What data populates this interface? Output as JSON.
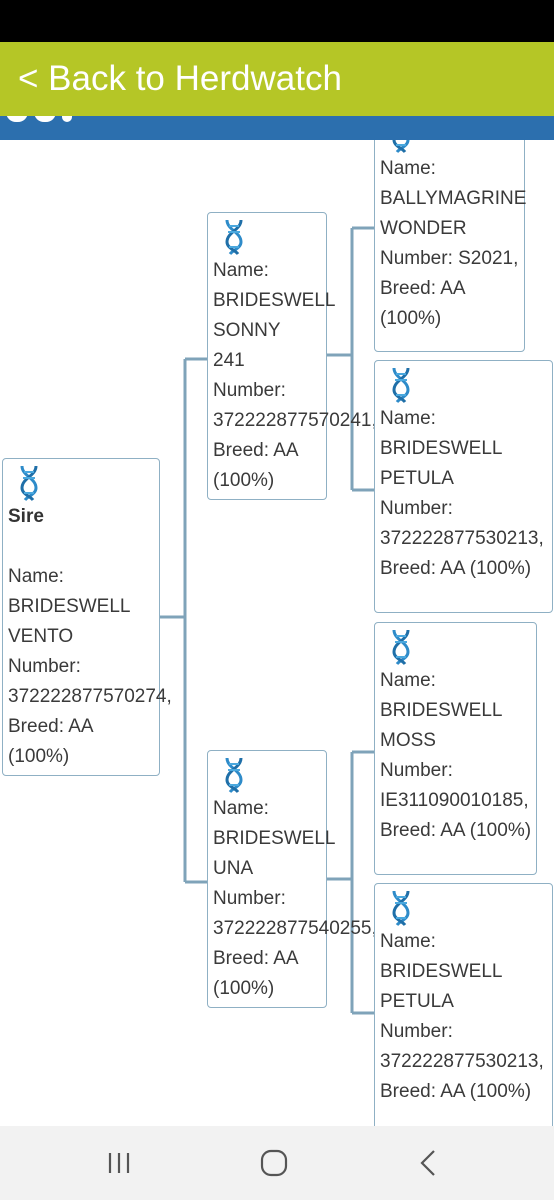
{
  "header": {
    "back_label": "< Back to Herdwatch"
  },
  "icons": {
    "dna": "dna-icon",
    "recents": "recent-apps-icon",
    "home": "home-icon",
    "back": "back-icon"
  },
  "colors": {
    "header_bg": "#b5c626",
    "band": "#2c6fae",
    "card_border": "#8fb0c4",
    "connector": "#7fa3b9"
  },
  "pedigree": {
    "sire": {
      "label": "Sire",
      "name_label": "Name:",
      "name": [
        "BRIDESWELL",
        "VENTO"
      ],
      "number_label": "Number:",
      "number": "372222877570274,",
      "breed_label": "Breed: AA",
      "breed_pct": "(100%)"
    },
    "sire_sire": {
      "name_label": "Name:",
      "name": [
        "BRIDESWELL",
        "SONNY",
        "241"
      ],
      "number_label": "Number:",
      "number": "372222877570241,",
      "breed_label": "Breed: AA",
      "breed_pct": "(100%)"
    },
    "sire_dam": {
      "name_label": "Name:",
      "name": [
        "BRIDESWELL",
        "UNA"
      ],
      "number_label": "Number:",
      "number": "372222877540255,",
      "breed_label": "Breed: AA",
      "breed_pct": "(100%)"
    },
    "ss_sire": {
      "name_label": "Name:",
      "name": [
        "BALLYMAGRINE",
        "WONDER"
      ],
      "number_line": "Number: S2021,",
      "breed_label": "Breed: AA",
      "breed_pct": "(100%)"
    },
    "ss_dam": {
      "name_label": "Name:",
      "name": [
        "BRIDESWELL",
        "PETULA"
      ],
      "number_label": "Number:",
      "number": "372222877530213,",
      "breed_line": "Breed: AA (100%)"
    },
    "sd_sire": {
      "name_label": "Name:",
      "name": [
        "BRIDESWELL",
        "MOSS"
      ],
      "number_label": "Number:",
      "number": "IE311090010185,",
      "breed_line": "Breed: AA (100%)"
    },
    "sd_dam": {
      "name_label": "Name:",
      "name": [
        "BRIDESWELL",
        "PETULA"
      ],
      "number_label": "Number:",
      "number": "372222877530213,",
      "breed_line": "Breed: AA (100%)"
    }
  }
}
